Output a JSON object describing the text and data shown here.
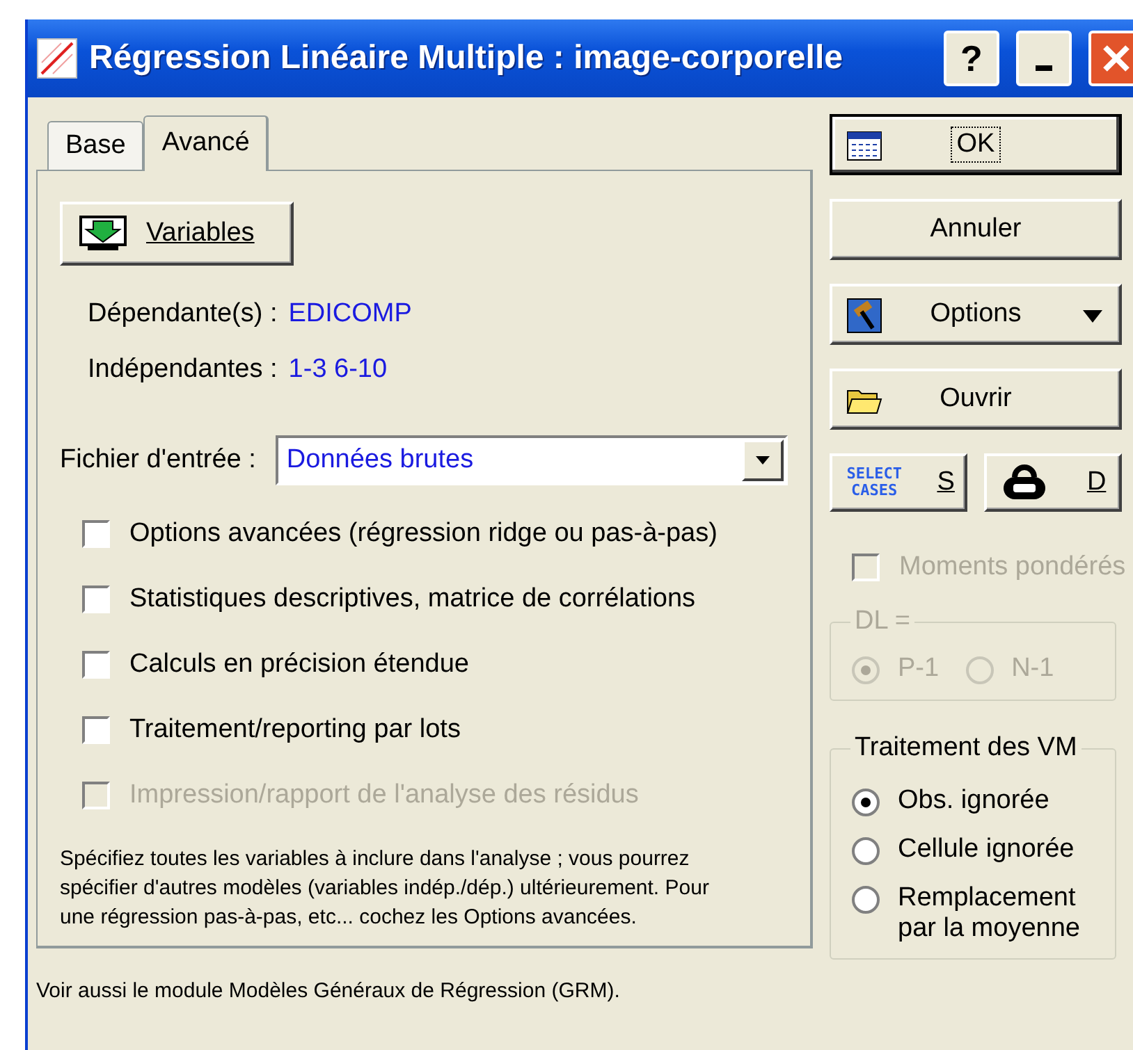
{
  "window": {
    "title": "Régression Linéaire Multiple : image-corporelle",
    "help": "?"
  },
  "tabs": [
    {
      "label": "Base",
      "selected": false
    },
    {
      "label": "Avancé",
      "selected": true
    }
  ],
  "variables_button": "Variables",
  "dependent": {
    "label": "Dépendante(s) :",
    "value": "EDICOMP"
  },
  "independent": {
    "label": "Indépendantes :",
    "value": "1-3 6-10"
  },
  "input_file": {
    "label": "Fichier d'entrée :",
    "value": "Données brutes"
  },
  "options": [
    {
      "label": "Options avancées (régression ridge ou pas-à-pas)",
      "checked": false,
      "disabled": false
    },
    {
      "label": "Statistiques descriptives, matrice de corrélations",
      "checked": false,
      "disabled": false
    },
    {
      "label": "Calculs en précision étendue",
      "checked": false,
      "disabled": false
    },
    {
      "label": "Traitement/reporting par lots",
      "checked": false,
      "disabled": false
    },
    {
      "label": "Impression/rapport de l'analyse des résidus",
      "checked": false,
      "disabled": true
    }
  ],
  "note": "Spécifiez toutes les variables à inclure dans l'analyse ; vous pourrez spécifier d'autres modèles (variables indép./dép.) ultérieurement.  Pour une régression pas-à-pas, etc... cochez les Options avancées.",
  "footer": "Voir aussi le module Modèles Généraux de Régression (GRM).",
  "actions": [
    {
      "kind": "ok",
      "label": "OK",
      "focused": true
    },
    {
      "kind": "plain",
      "label": "Annuler",
      "focused": false
    },
    {
      "kind": "options",
      "label": "Options",
      "focused": false
    },
    {
      "kind": "open",
      "label": "Ouvrir",
      "focused": false
    }
  ],
  "select_cases": {
    "badge": "SELECT CASES",
    "label": "S"
  },
  "weight": {
    "label": "D"
  },
  "weighted_moments": {
    "label": "Moments pondérés",
    "checked": false,
    "disabled": true
  },
  "dl": {
    "legend": "DL =",
    "disabled": true,
    "options": [
      {
        "label": "P-1",
        "selected": true
      },
      {
        "label": "N-1",
        "selected": false
      }
    ]
  },
  "missing": {
    "legend": "Traitement des VM",
    "disabled": false,
    "options": [
      {
        "label": "Obs. ignorée",
        "selected": true
      },
      {
        "label": "Cellule ignorée",
        "selected": false
      },
      {
        "label": "Remplacement par la moyenne",
        "selected": false
      }
    ]
  }
}
